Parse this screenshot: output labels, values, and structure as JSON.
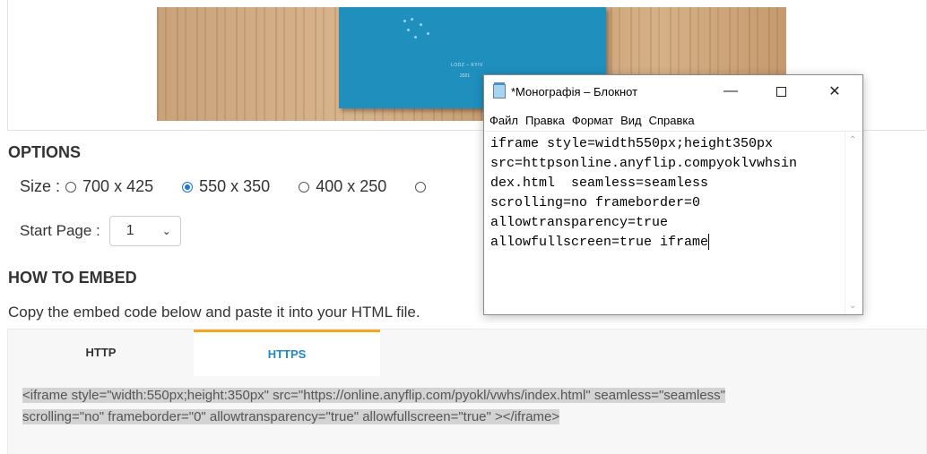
{
  "preview": {
    "book_caption": "LODZ – KYIV",
    "book_year": "2021"
  },
  "options": {
    "heading": "OPTIONS",
    "size_label": "Size :",
    "sizes": [
      {
        "label": "700 x 425",
        "selected": false
      },
      {
        "label": "550 x 350",
        "selected": true
      },
      {
        "label": "400 x 250",
        "selected": false
      }
    ],
    "start_page_label": "Start Page :",
    "start_page_value": "1"
  },
  "embed": {
    "heading": "HOW TO EMBED",
    "description": "Copy the embed code below and paste it into your HTML file.",
    "tabs": [
      "HTTP",
      "HTTPS"
    ],
    "active_tab": "HTTPS",
    "code_line1": "<iframe style=\"width:550px;height:350px\" src=\"https://online.anyflip.com/pyokl/vwhs/index.html\"  seamless=\"seamless\"",
    "code_line2": "scrolling=\"no\" frameborder=\"0\" allowtransparency=\"true\" allowfullscreen=\"true\" ></iframe>"
  },
  "notepad": {
    "title": "*Монографія – Блокнот",
    "menu": [
      "Файл",
      "Правка",
      "Формат",
      "Вид",
      "Справка"
    ],
    "lines": [
      "iframe style=width550px;height350px",
      "src=httpsonline.anyflip.compyoklvwhsin",
      "dex.html  seamless=seamless",
      "scrolling=no frameborder=0",
      "allowtransparency=true",
      "allowfullscreen=true iframe"
    ]
  }
}
